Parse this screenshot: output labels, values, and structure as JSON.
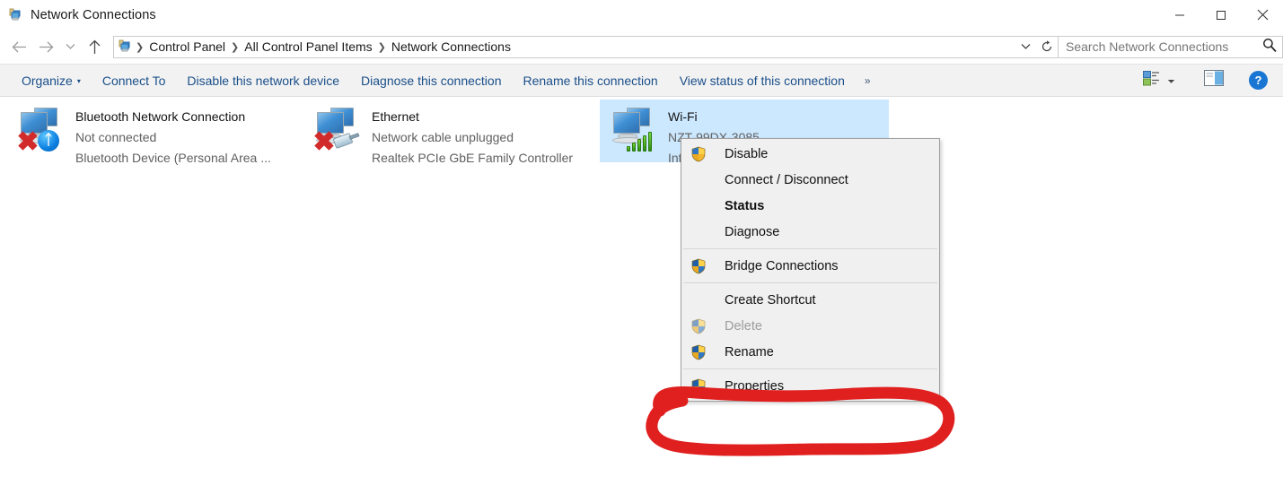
{
  "window": {
    "title": "Network Connections",
    "icon": "network-connections-icon",
    "controls": {
      "minimize": "─",
      "maximize": "□",
      "close": "✕"
    }
  },
  "addressbar": {
    "back": "←",
    "forward": "→",
    "recent": "⌄",
    "up": "↑",
    "icon": "control-panel-icon",
    "breadcrumbs": [
      "Control Panel",
      "All Control Panel Items",
      "Network Connections"
    ],
    "separator": "❯",
    "dropdown": "⌄",
    "refresh": "↻",
    "search": {
      "placeholder": "Search Network Connections",
      "value": "",
      "icon": "search-icon"
    }
  },
  "commandbar": {
    "items": [
      {
        "label": "Organize",
        "has_caret": true
      },
      {
        "label": "Connect To",
        "has_caret": false
      },
      {
        "label": "Disable this network device",
        "has_caret": false
      },
      {
        "label": "Diagnose this connection",
        "has_caret": false
      },
      {
        "label": "Rename this connection",
        "has_caret": false
      },
      {
        "label": "View status of this connection",
        "has_caret": false
      }
    ],
    "overflow": "»",
    "caret": "▾",
    "view_icon": "change-view-icon",
    "view_caret": "▾",
    "preview_icon": "preview-pane-icon",
    "help_icon": "help-icon",
    "help_label": "?"
  },
  "connections": [
    {
      "name": "Bluetooth Network Connection",
      "status": "Not connected",
      "device": "Bluetooth Device (Personal Area ...",
      "icon": "network-adapter-icon",
      "badge": "bluetooth-badge-icon",
      "disconnected": true,
      "selected": false
    },
    {
      "name": "Ethernet",
      "status": "Network cable unplugged",
      "device": "Realtek PCIe GbE Family Controller",
      "icon": "network-adapter-icon",
      "badge": "unplugged-cable-badge-icon",
      "disconnected": true,
      "selected": false
    },
    {
      "name": "Wi-Fi",
      "status": "NZT-99DX-3085",
      "device": "Intel(R) Wireless-AC 9560",
      "icon": "network-adapter-icon",
      "badge": "signal-bars-badge-icon",
      "disconnected": false,
      "selected": true
    }
  ],
  "context_menu": [
    {
      "label": "Disable",
      "shield": true,
      "bold": false,
      "disabled": false,
      "type": "item"
    },
    {
      "label": "Connect / Disconnect",
      "shield": false,
      "bold": false,
      "disabled": false,
      "type": "item"
    },
    {
      "label": "Status",
      "shield": false,
      "bold": true,
      "disabled": false,
      "type": "item"
    },
    {
      "label": "Diagnose",
      "shield": false,
      "bold": false,
      "disabled": false,
      "type": "item"
    },
    {
      "type": "separator"
    },
    {
      "label": "Bridge Connections",
      "shield": true,
      "bold": false,
      "disabled": false,
      "type": "item"
    },
    {
      "type": "separator"
    },
    {
      "label": "Create Shortcut",
      "shield": false,
      "bold": false,
      "disabled": false,
      "type": "item"
    },
    {
      "label": "Delete",
      "shield": true,
      "bold": false,
      "disabled": true,
      "type": "item"
    },
    {
      "label": "Rename",
      "shield": true,
      "bold": false,
      "disabled": false,
      "type": "item"
    },
    {
      "label": "Properties",
      "shield": true,
      "bold": false,
      "disabled": false,
      "type": "item"
    }
  ],
  "annotation": {
    "shape": "hand-drawn-ellipse",
    "color": "#e01f1f",
    "target": "Properties"
  }
}
